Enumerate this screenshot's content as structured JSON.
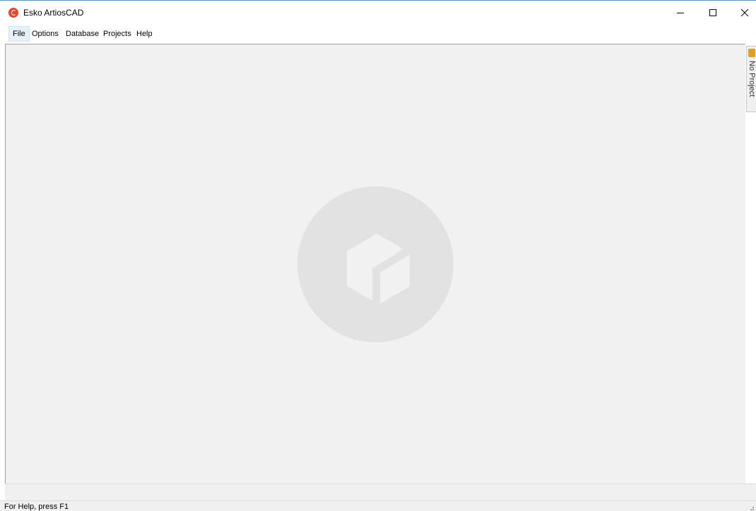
{
  "window": {
    "title": "Esko ArtiosCAD",
    "icon": "artioscad-logo-icon",
    "accent_color": "#e8452c"
  },
  "menu": {
    "items": [
      {
        "label": "File",
        "active": true
      },
      {
        "label": "Options"
      },
      {
        "label": "Database"
      },
      {
        "label": "Projects"
      },
      {
        "label": "Help"
      }
    ]
  },
  "sidebar_tab": {
    "label": "No Project",
    "icon": "project-folder-icon"
  },
  "workspace": {
    "background_color": "#f1f1f1",
    "watermark_icon": "box-logo-icon"
  },
  "status": {
    "text": "For Help, press F1"
  }
}
